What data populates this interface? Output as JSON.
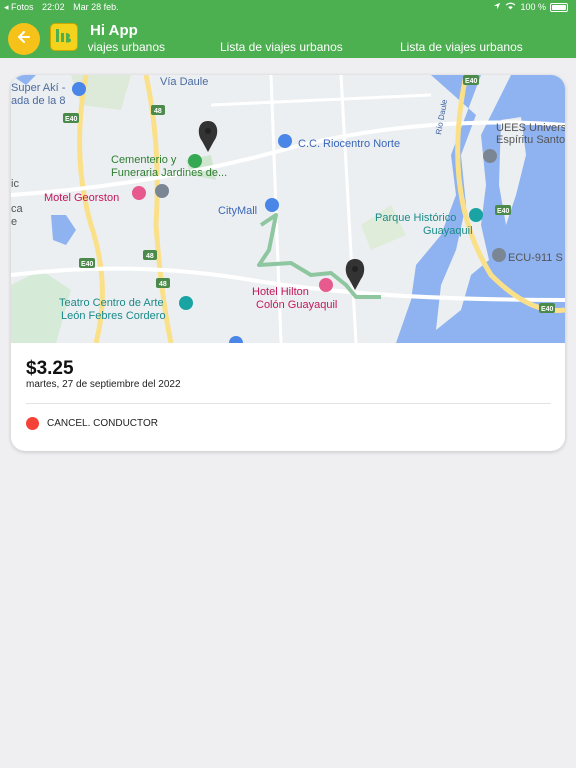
{
  "status_bar": {
    "back_app": "◂ Fotos",
    "time": "22:02",
    "date": "Mar 28 feb.",
    "battery": "100 %"
  },
  "header": {
    "title": "Hi App",
    "tabs": [
      {
        "label": "Lista de viajes urbanos"
      },
      {
        "label": "Lista de viajes urbanos"
      },
      {
        "label": "Lista de viajes urbanos"
      }
    ]
  },
  "trip": {
    "price": "$3.25",
    "date": "martes, 27 de septiembre del 2022",
    "status": "CANCEL. CONDUCTOR",
    "status_color": "#f44336"
  },
  "map": {
    "labels": {
      "via_daule": "Vía Daule",
      "super_aki": "Super Akí -",
      "ada_8": "ada de la 8",
      "cementerio": "Cementerio y",
      "funeraria": "Funeraria Jardines de...",
      "motel": "Motel Georston",
      "citymall": "CityMall",
      "riocentro": "C.C. Riocentro Norte",
      "uees": "UEES Universidad",
      "espiritu": "Espíritu Santo",
      "parque1": "Parque Histórico",
      "parque2": "Guayaquil",
      "ecu": "ECU-911 S",
      "teatro1": "Teatro Centro de Arte",
      "teatro2": "León Febres Cordero",
      "hilton1": "Hotel Hilton",
      "hilton2": "Colón Guayaquil",
      "rio_daule": "Río Daule",
      "e40": "E40",
      "r48": "48",
      "ic": "ic",
      "ca": "ca",
      "e_letter": "e"
    }
  }
}
